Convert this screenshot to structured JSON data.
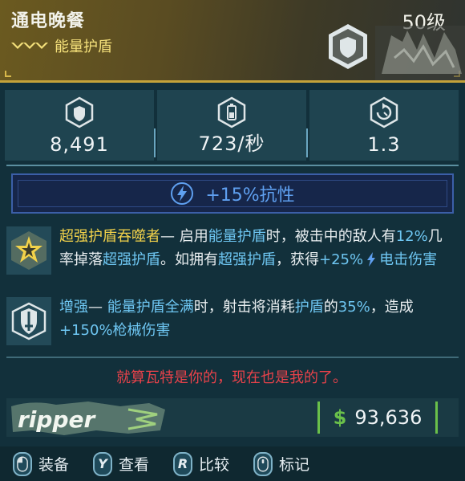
{
  "item": {
    "name": "通电晚餐",
    "level": "50级",
    "type": "能量护盾",
    "rarity_color": "#f4e07a"
  },
  "stats": [
    {
      "icon": "shield-capacity-icon",
      "value": "8,491"
    },
    {
      "icon": "recharge-rate-icon",
      "value": "723/秒"
    },
    {
      "icon": "recharge-delay-icon",
      "value": "1.3"
    }
  ],
  "element": {
    "icon": "shock-icon",
    "text": "+15%抗性",
    "color": "#5fa0f0"
  },
  "perks": [
    {
      "icon": "star-perk-icon",
      "title": "超强护盾吞噬者",
      "t1": "— 启用",
      "h1": "能量护盾",
      "t2": "时，被击中的敌人有",
      "h2": "12%",
      "t3": "几率掉落",
      "h3": "超强护盾",
      "t4": "。如拥有",
      "h4": "超强护盾",
      "t5": "，获得",
      "h5": "+25%",
      "h6": "电击伤害"
    },
    {
      "icon": "shield-sword-perk-icon",
      "title": "增强",
      "t1": "— ",
      "h1": "能量护盾全满",
      "t2": "时，射击将消耗",
      "h2": "护盾",
      "t3": "的",
      "h3": "35%",
      "t4": "，造成",
      "h4": "+150%枪械伤害"
    }
  ],
  "flavor_text": "就算瓦特是你的，现在也是我的了。",
  "manufacturer": {
    "name": "ripper"
  },
  "price": {
    "symbol": "$",
    "value": "93,636"
  },
  "actions": [
    {
      "key": "",
      "label": "装备"
    },
    {
      "key": "Y",
      "label": "查看"
    },
    {
      "key": "R",
      "label": "比较"
    },
    {
      "key": "",
      "label": "标记"
    }
  ]
}
